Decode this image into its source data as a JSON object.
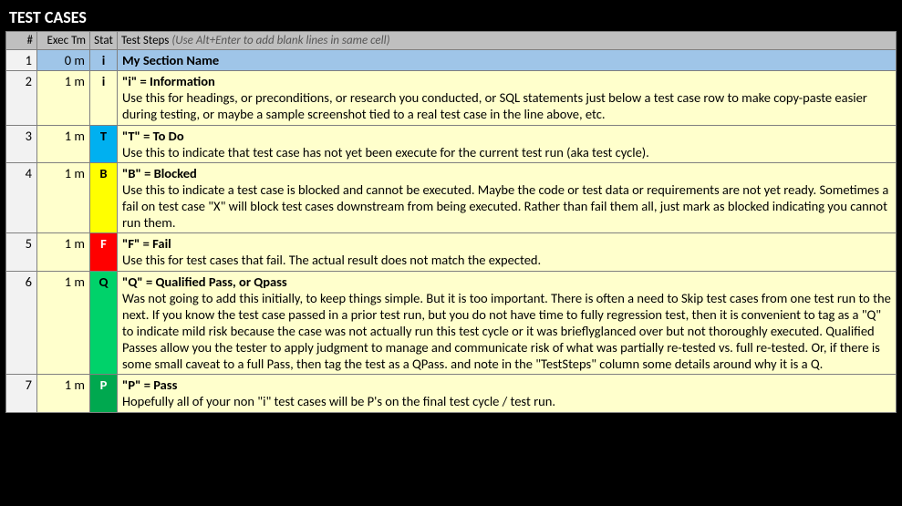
{
  "title": "TEST CASES",
  "headers": {
    "num": "#",
    "exec": "Exec Tm",
    "stat": "Stat",
    "steps": "Test Steps",
    "steps_hint": "(Use Alt+Enter to add blank lines in same cell)"
  },
  "rows": [
    {
      "num": "1",
      "exec": "0 m",
      "stat": "i",
      "stat_class": "stat-i",
      "row_class": "row-blue",
      "heading": "My Section Name",
      "body": ""
    },
    {
      "num": "2",
      "exec": "1 m",
      "stat": "i",
      "stat_class": "stat-i",
      "row_class": "row-yellow",
      "heading": "\"i\" = Information",
      "body": "Use this for headings, or preconditions, or research you conducted, or SQL statements just below a test case row to make copy-paste easier during testing, or maybe a sample screenshot tied to a real test case in the line above, etc."
    },
    {
      "num": "3",
      "exec": "1 m",
      "stat": "T",
      "stat_class": "stat-T",
      "row_class": "row-yellow",
      "heading": "\"T\" = To Do",
      "body": "Use this to indicate that test case has not yet been execute for the current test run (aka test cycle)."
    },
    {
      "num": "4",
      "exec": "1 m",
      "stat": "B",
      "stat_class": "stat-B",
      "row_class": "row-yellow",
      "heading": "\"B\" = Blocked",
      "body": "Use this to indicate a test case is blocked and cannot be executed.  Maybe the code or test data or requirements are not yet ready. Sometimes a fail on test case \"X\" will block test cases downstream from being executed.  Rather than fail them all, just mark as blocked indicating you cannot run them."
    },
    {
      "num": "5",
      "exec": "1 m",
      "stat": "F",
      "stat_class": "stat-F",
      "row_class": "row-yellow",
      "heading": "\"F\" = Fail",
      "body": "Use this for test cases that fail.  The actual result does not match the expected."
    },
    {
      "num": "6",
      "exec": "1 m",
      "stat": "Q",
      "stat_class": "stat-Q",
      "row_class": "row-yellow",
      "heading": "\"Q\" = Qualified Pass, or Qpass",
      "body": "Was not going to add this initially, to keep things simple.  But it is too important.  There is often a need to Skip test cases from one test run to the next.  If you know the test case passed in a prior test run, but you do not have time to fully regression test, then it is convenient to tag as a \"Q\" to indicate mild risk because the case was not actually run this test cycle or it was brieflyglanced over but not thoroughly executed.  Qualified Passes allow you the tester to apply judgment to manage and communicate risk of what was partially re-tested vs. full re-tested.  Or, if there is some small caveat to a full Pass, then tag the test as a QPass. and note in the \"TestSteps\" column some details around why it is a Q."
    },
    {
      "num": "7",
      "exec": "1 m",
      "stat": "P",
      "stat_class": "stat-P",
      "row_class": "row-yellow",
      "heading": "\"P\" = Pass",
      "body": "Hopefully all of your non \"i\" test cases will be P's on the final test cycle / test run."
    }
  ]
}
